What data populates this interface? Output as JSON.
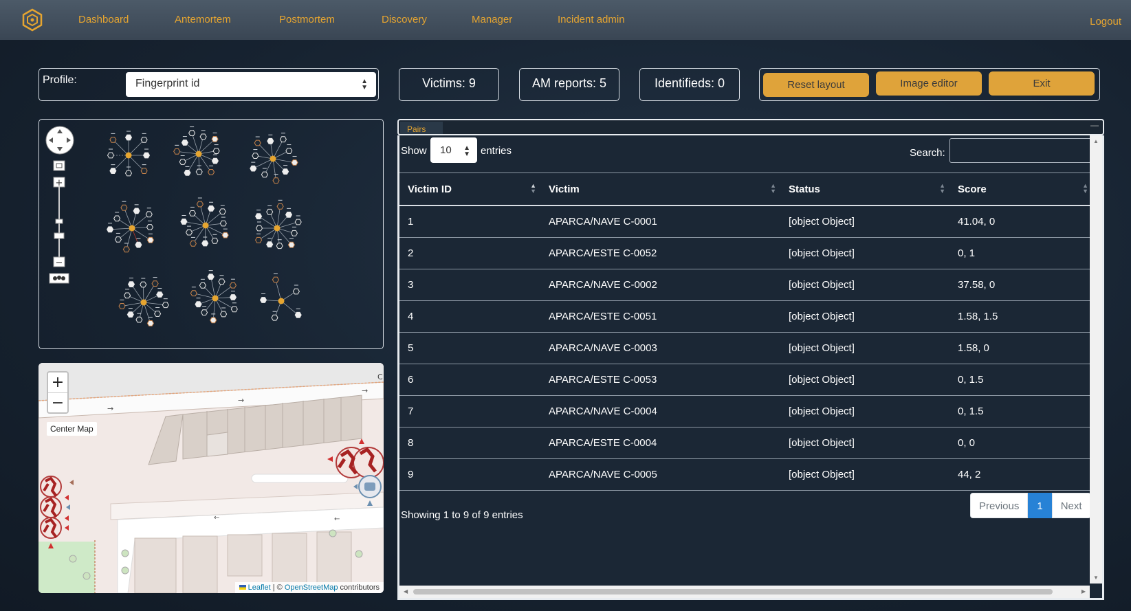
{
  "nav": {
    "items": [
      "Dashboard",
      "Antemortem",
      "Postmortem",
      "Discovery",
      "Manager",
      "Incident admin"
    ],
    "logout": "Logout"
  },
  "profile": {
    "label": "Profile:",
    "value": "Fingerprint id"
  },
  "stats": {
    "victims": "Victims: 9",
    "am_reports": "AM reports: 5",
    "identifieds": "Identifieds: 0"
  },
  "buttons": {
    "reset_layout": "Reset layout",
    "image_editor": "Image editor",
    "exit": "Exit"
  },
  "map": {
    "zoom_in": "+",
    "zoom_out": "−",
    "center_map": "Center Map",
    "attribution_leaflet": "Leaflet",
    "attribution_sep": " | © ",
    "attribution_osm": "OpenStreetMap",
    "attribution_tail": " contributors"
  },
  "pairs": {
    "tab": "Pairs",
    "show_label": "Show",
    "length_value": "10",
    "entries_label": "entries",
    "search_label": "Search:",
    "search_value": "",
    "columns": [
      "Victim ID",
      "Victim",
      "Status",
      "Score"
    ],
    "rows": [
      {
        "id": "1",
        "victim": "APARCA/NAVE C-0001",
        "status": "[object Object]",
        "score": "41.04, 0"
      },
      {
        "id": "2",
        "victim": "APARCA/ESTE C-0052",
        "status": "[object Object]",
        "score": "0, 1"
      },
      {
        "id": "3",
        "victim": "APARCA/NAVE C-0002",
        "status": "[object Object]",
        "score": "37.58, 0"
      },
      {
        "id": "4",
        "victim": "APARCA/ESTE C-0051",
        "status": "[object Object]",
        "score": "1.58, 1.5"
      },
      {
        "id": "5",
        "victim": "APARCA/NAVE C-0003",
        "status": "[object Object]",
        "score": "1.58, 0"
      },
      {
        "id": "6",
        "victim": "APARCA/ESTE C-0053",
        "status": "[object Object]",
        "score": "0, 1.5"
      },
      {
        "id": "7",
        "victim": "APARCA/NAVE C-0004",
        "status": "[object Object]",
        "score": "0, 1.5"
      },
      {
        "id": "8",
        "victim": "APARCA/ESTE C-0004",
        "status": "[object Object]",
        "score": "0, 0"
      },
      {
        "id": "9",
        "victim": "APARCA/NAVE C-0005",
        "status": "[object Object]",
        "score": "44, 2"
      }
    ],
    "info": "Showing 1 to 9 of 9 entries",
    "pagination": {
      "previous": "Previous",
      "current": "1",
      "next": "Next"
    }
  },
  "colors": {
    "accent": "#e6a530",
    "button": "#dfa33a",
    "active_page": "#2782d6",
    "node_center": "#e6a530",
    "link_highlight": "#c0392b"
  },
  "icons": {
    "brand": "hexagon-logo-icon",
    "graph_controls": [
      "pan-control-icon",
      "fit-screen-icon",
      "zoom-in-icon",
      "zoom-slider-icon",
      "zoom-out-icon",
      "group-icon"
    ],
    "map_markers": "victim-marker-icon"
  },
  "graph": {
    "clusters": 9
  }
}
